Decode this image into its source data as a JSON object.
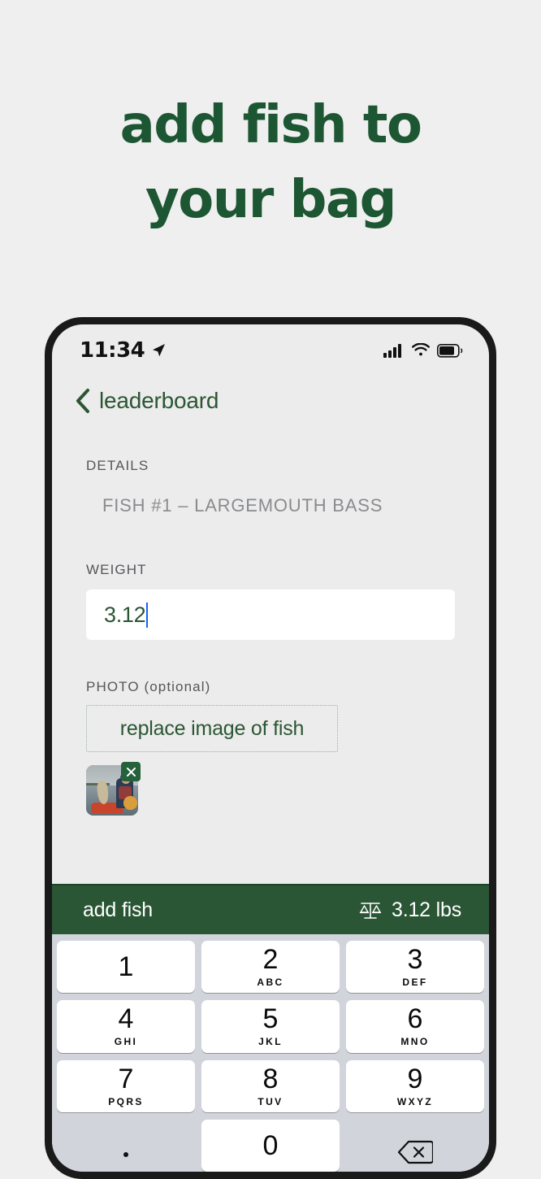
{
  "promo": {
    "line1": "add fish to",
    "line2": "your bag",
    "color": "#1D5632"
  },
  "status_bar": {
    "time": "11:34",
    "location_icon": "location-arrow-icon",
    "signal_icon": "cellular-signal-icon",
    "wifi_icon": "wifi-icon",
    "battery_icon": "battery-icon",
    "battery_level_pct": 70
  },
  "nav": {
    "back_icon": "chevron-left-icon",
    "back_label": "leaderboard",
    "color": "#2B5634"
  },
  "form": {
    "details_label": "DETAILS",
    "details_value": "FISH #1 – LARGEMOUTH BASS",
    "weight_label": "WEIGHT",
    "weight_value": "3.12",
    "photo_label": "PHOTO (optional)",
    "photo_button_label": "replace image of fish",
    "photo_thumbnail_alt": "angler in kayak holding a largemouth bass",
    "photo_remove_icon": "close-x-icon"
  },
  "action_bar": {
    "submit_label": "add fish",
    "scale_icon": "balance-scale-icon",
    "weight_readout": "3.12 lbs",
    "background": "#2A5635"
  },
  "keypad": {
    "background": "#D1D5DB",
    "rows": [
      [
        {
          "digit": "1",
          "letters": ""
        },
        {
          "digit": "2",
          "letters": "ABC"
        },
        {
          "digit": "3",
          "letters": "DEF"
        }
      ],
      [
        {
          "digit": "4",
          "letters": "GHI"
        },
        {
          "digit": "5",
          "letters": "JKL"
        },
        {
          "digit": "6",
          "letters": "MNO"
        }
      ],
      [
        {
          "digit": "7",
          "letters": "PQRS"
        },
        {
          "digit": "8",
          "letters": "TUV"
        },
        {
          "digit": "9",
          "letters": "WXYZ"
        }
      ],
      [
        {
          "digit": ".",
          "letters": ""
        },
        {
          "digit": "0",
          "letters": ""
        },
        {
          "digit": "",
          "letters": "",
          "icon": "backspace-icon"
        }
      ]
    ]
  }
}
